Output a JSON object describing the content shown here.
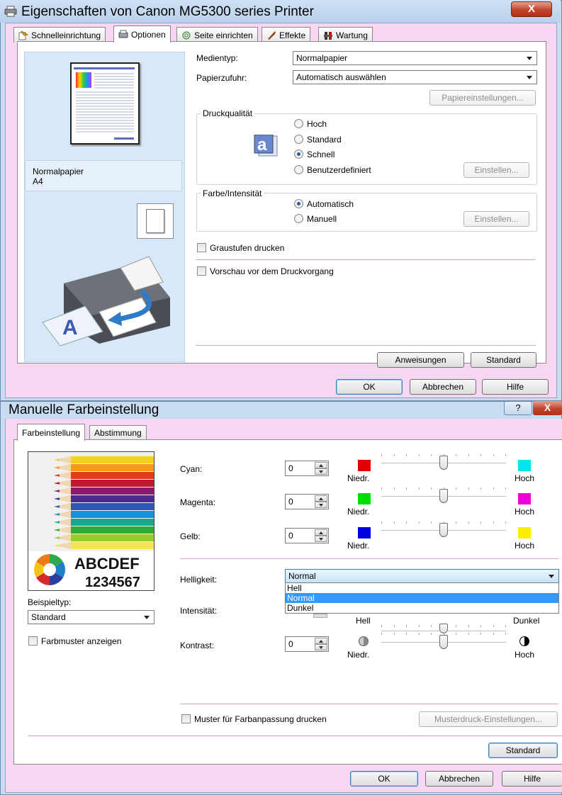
{
  "dialog1": {
    "title": "Eigenschaften von Canon MG5300 series Printer",
    "close_glyph": "X",
    "tabs": [
      {
        "label": "Schnelleinrichtung",
        "icon": "quick-setup-icon"
      },
      {
        "label": "Optionen",
        "icon": "options-icon"
      },
      {
        "label": "Seite einrichten",
        "icon": "page-setup-icon"
      },
      {
        "label": "Effekte",
        "icon": "effects-icon"
      },
      {
        "label": "Wartung",
        "icon": "maintenance-icon"
      }
    ],
    "preview": {
      "media": "Normalpapier",
      "size": "A4"
    },
    "media_type": {
      "label": "Medientyp:",
      "value": "Normalpapier"
    },
    "paper_source": {
      "label": "Papierzufuhr:",
      "value": "Automatisch auswählen"
    },
    "paper_settings_button": "Papiereinstellungen...",
    "print_quality": {
      "legend": "Druckqualität",
      "options": [
        "Hoch",
        "Standard",
        "Schnell",
        "Benutzerdefiniert"
      ],
      "selected": "Schnell",
      "set_button": "Einstellen..."
    },
    "color_intensity": {
      "legend": "Farbe/Intensität",
      "options": [
        "Automatisch",
        "Manuell"
      ],
      "selected": "Automatisch",
      "set_button": "Einstellen..."
    },
    "grayscale": {
      "label": "Graustufen drucken",
      "checked": false
    },
    "preview_before_print": {
      "label": "Vorschau vor dem Druckvorgang",
      "checked": false
    },
    "instructions_button": "Anweisungen",
    "defaults_button": "Standard",
    "ok_button": "OK",
    "cancel_button": "Abbrechen",
    "help_button": "Hilfe"
  },
  "dialog2": {
    "title": "Manuelle Farbeinstellung",
    "help_glyph": "?",
    "close_glyph": "X",
    "tabs": [
      "Farbeinstellung",
      "Abstimmung"
    ],
    "sample_text_line1": "ABCDEF",
    "sample_text_line2": "1234567",
    "sample_type_label": "Beispieltyp:",
    "sample_type_value": "Standard",
    "show_color_pattern": {
      "label": "Farbmuster anzeigen",
      "checked": false
    },
    "sliders": [
      {
        "label": "Cyan:",
        "value": "0",
        "low_label": "Niedr.",
        "high_label": "Hoch",
        "low_color": "#e00000",
        "high_color": "#00e5ee",
        "level": 0
      },
      {
        "label": "Magenta:",
        "value": "0",
        "low_label": "Niedr.",
        "high_label": "Hoch",
        "low_color": "#00dd00",
        "high_color": "#ee00dd",
        "level": 0
      },
      {
        "label": "Gelb:",
        "value": "0",
        "low_label": "Niedr.",
        "high_label": "Hoch",
        "low_color": "#0000dd",
        "high_color": "#ffee00",
        "level": 0
      }
    ],
    "brightness": {
      "label": "Helligkeit:",
      "value": "Normal",
      "options": [
        "Hell",
        "Normal",
        "Dunkel"
      ],
      "selected": "Normal"
    },
    "intensity": {
      "label": "Intensität:",
      "low_label": "Hell",
      "high_label": "Dunkel"
    },
    "contrast": {
      "label": "Kontrast:",
      "value": "0",
      "low_label": "Niedr.",
      "high_label": "Hoch",
      "level": 0
    },
    "print_pattern": {
      "label": "Muster für Farbanpassung drucken",
      "checked": false
    },
    "pattern_settings_button": "Musterdruck-Einstellungen...",
    "defaults_button": "Standard",
    "ok_button": "OK",
    "cancel_button": "Abbrechen",
    "help_button": "Hilfe"
  }
}
